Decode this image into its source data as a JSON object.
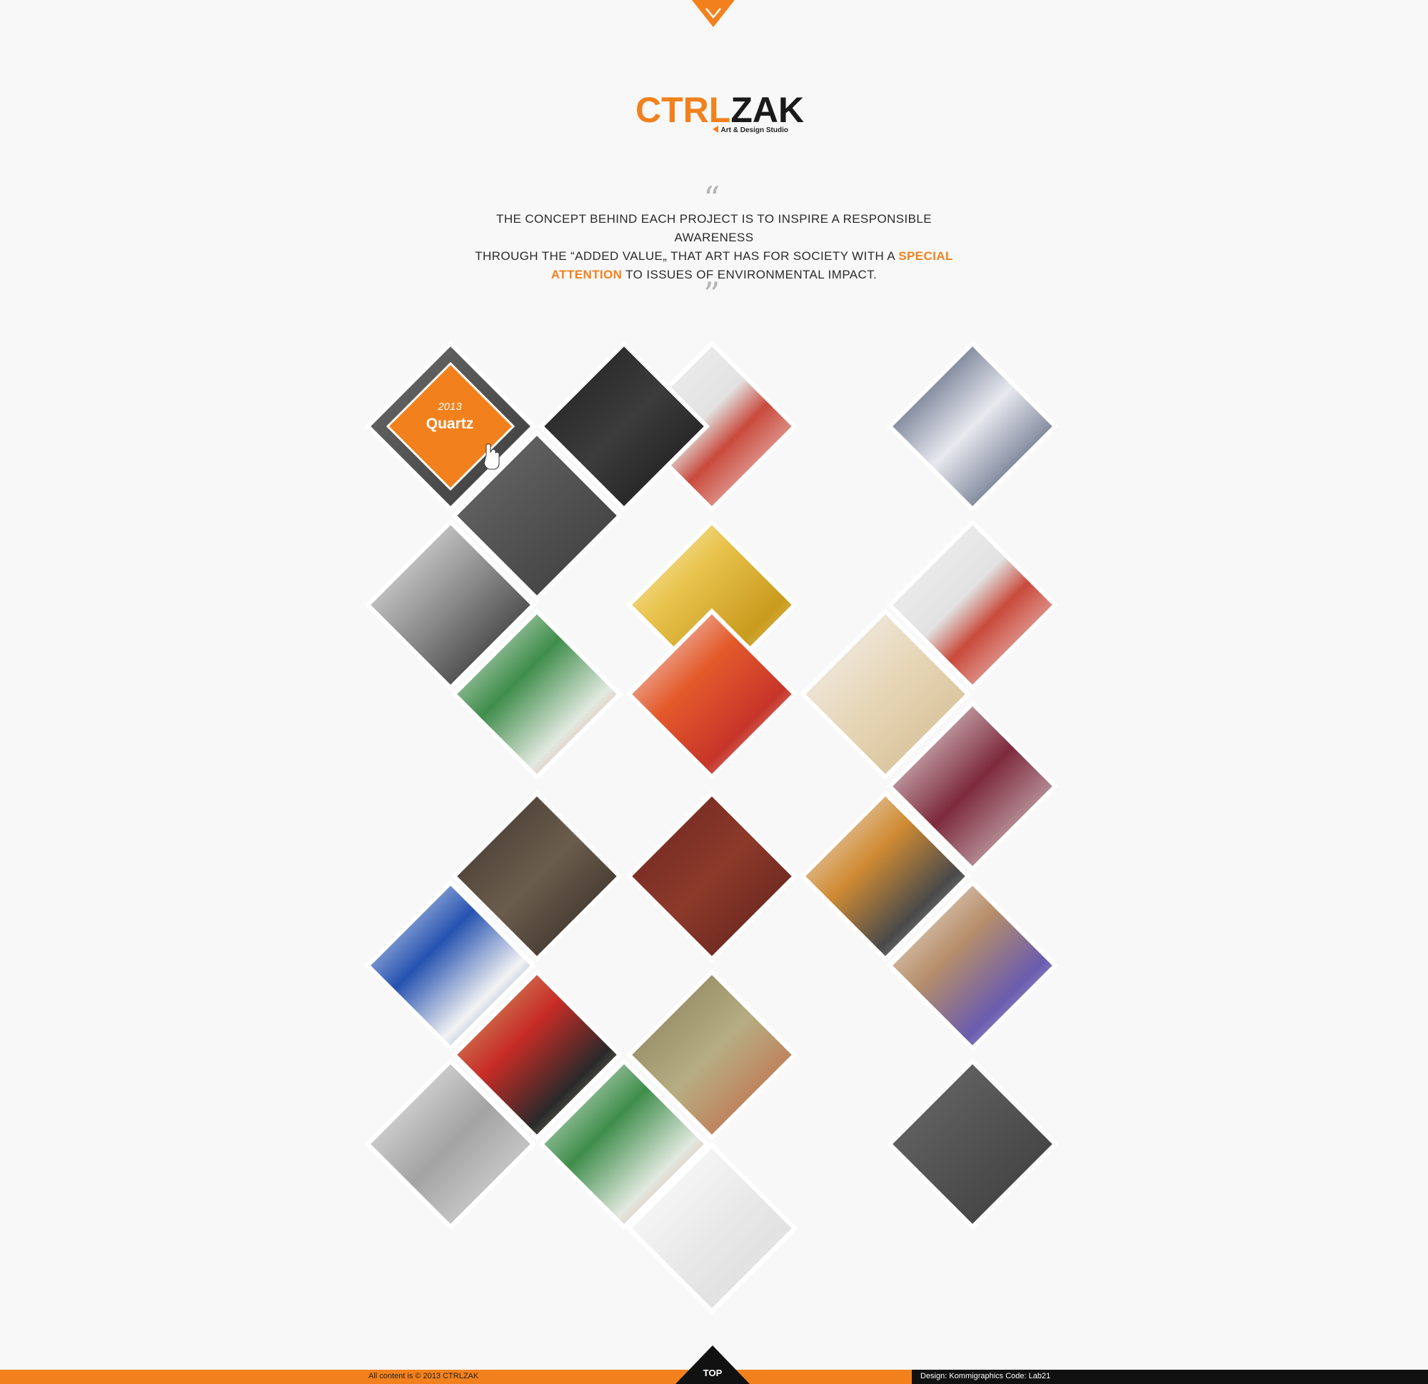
{
  "header": {
    "dropdown_icon": "chevron-down-icon"
  },
  "logo": {
    "part1": "CTRL",
    "part2": "ZAK",
    "tagline": "Art & Design Studio"
  },
  "quote": {
    "open_mark": "“",
    "close_mark": "”",
    "line1": "THE CONCEPT BEHIND EACH PROJECT IS TO INSPIRE A RESPONSIBLE AWARENESS",
    "line2_pre": "THROUGH THE “ADDED VALUE„ THAT ART HAS FOR SOCIETY WITH A ",
    "highlight1": "SPECIAL",
    "highlight2": "ATTENTION",
    "line3_post": " TO ISSUES OF ENVIRONMENTAL IMPACT."
  },
  "featured": {
    "year": "2013",
    "title": "Quartz"
  },
  "footer": {
    "copyright": "All content is © 2013 CTRLZAK",
    "credits": "Design: Kommigraphics   Code: Lab21",
    "top_label": "TOP"
  },
  "colors": {
    "accent": "#f2811d",
    "dark": "#111111",
    "background": "#f8f8f8"
  },
  "projects": [
    {
      "name": "quartz-project",
      "theme": "orange"
    },
    {
      "name": "porcelain-cups",
      "theme": "porcelain"
    },
    {
      "name": "golden-man",
      "theme": "gold"
    },
    {
      "name": "floral-print",
      "theme": "floral"
    },
    {
      "name": "geisha-performer",
      "theme": "kimono"
    },
    {
      "name": "wooden-box",
      "theme": "wood"
    },
    {
      "name": "cave-forest",
      "theme": "earth"
    },
    {
      "name": "red-fabric",
      "theme": "burgundy"
    },
    {
      "name": "sunglasses-display",
      "theme": "amber"
    },
    {
      "name": "patchwork-quilt",
      "theme": "redgold"
    },
    {
      "name": "japanese-print",
      "theme": "olive"
    },
    {
      "name": "lace-dress",
      "theme": "lace"
    },
    {
      "name": "half-face-portrait",
      "theme": "skin"
    },
    {
      "name": "zen-blackboard",
      "theme": "slate"
    },
    {
      "name": "damask-textile",
      "theme": "navy"
    },
    {
      "name": "designers-portrait",
      "theme": "bw"
    },
    {
      "name": "porcelain-bowls",
      "theme": "porcelain"
    },
    {
      "name": "dragon-cup",
      "theme": "crimsoncup"
    },
    {
      "name": "blue-wave-pattern",
      "theme": "blue"
    },
    {
      "name": "street-couple",
      "theme": "street"
    },
    {
      "name": "grey-textile",
      "theme": "grey"
    },
    {
      "name": "floral-tiles",
      "theme": "floral"
    }
  ]
}
